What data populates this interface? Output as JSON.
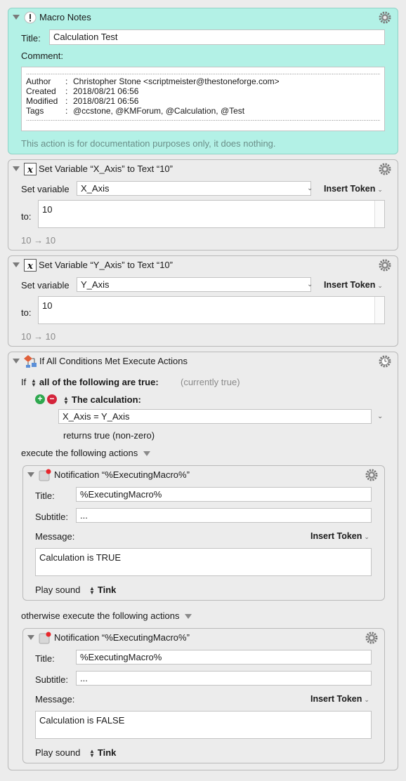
{
  "macro_notes": {
    "title": "Macro Notes",
    "title_label": "Title:",
    "title_value": "Calculation Test",
    "comment_label": "Comment:",
    "dots": "....................................................................................................................................................................................................................",
    "rows": [
      {
        "key": "Author",
        "value": "Christopher Stone <scriptmeister@thestoneforge.com>"
      },
      {
        "key": "Created",
        "value": "2018/08/21 06:56"
      },
      {
        "key": "Modified",
        "value": "2018/08/21 06:56"
      },
      {
        "key": "Tags",
        "value": "@ccstone, @KMForum, @Calculation, @Test"
      }
    ],
    "footer": "This action is for documentation purposes only, it does nothing."
  },
  "set_var_x": {
    "title": "Set Variable “X_Axis” to Text “10”",
    "var_label": "Set variable",
    "var_value": "X_Axis",
    "insert_token": "Insert Token",
    "to_label": "to:",
    "to_value": "10",
    "preview": "10 → 10"
  },
  "set_var_y": {
    "title": "Set Variable “Y_Axis” to Text “10”",
    "var_label": "Set variable",
    "var_value": "Y_Axis",
    "insert_token": "Insert Token",
    "to_label": "to:",
    "to_value": "10",
    "preview": "10 → 10"
  },
  "if_block": {
    "title": "If All Conditions Met Execute Actions",
    "if_label": "If",
    "condition_mode": "all of the following are true:",
    "status": "(currently true)",
    "calc_label": "The calculation:",
    "calc_value": "X_Axis = Y_Axis",
    "returns": "returns true (non-zero)",
    "then_label": "execute the following actions",
    "else_label": "otherwise execute the following actions"
  },
  "notif_true": {
    "title": "Notification “%ExecutingMacro%”",
    "title_label": "Title:",
    "title_value": "%ExecutingMacro%",
    "subtitle_label": "Subtitle:",
    "subtitle_value": "...",
    "message_label": "Message:",
    "insert_token": "Insert Token",
    "message_value": "Calculation is TRUE",
    "sound_label": "Play sound",
    "sound_value": "Tink"
  },
  "notif_false": {
    "title": "Notification “%ExecutingMacro%”",
    "title_label": "Title:",
    "title_value": "%ExecutingMacro%",
    "subtitle_label": "Subtitle:",
    "subtitle_value": "...",
    "message_label": "Message:",
    "insert_token": "Insert Token",
    "message_value": "Calculation is FALSE",
    "sound_label": "Play sound",
    "sound_value": "Tink"
  },
  "colors": {
    "notes_bg": "#b3f1e6",
    "plus": "#2fa84f",
    "minus": "#d4243b"
  }
}
